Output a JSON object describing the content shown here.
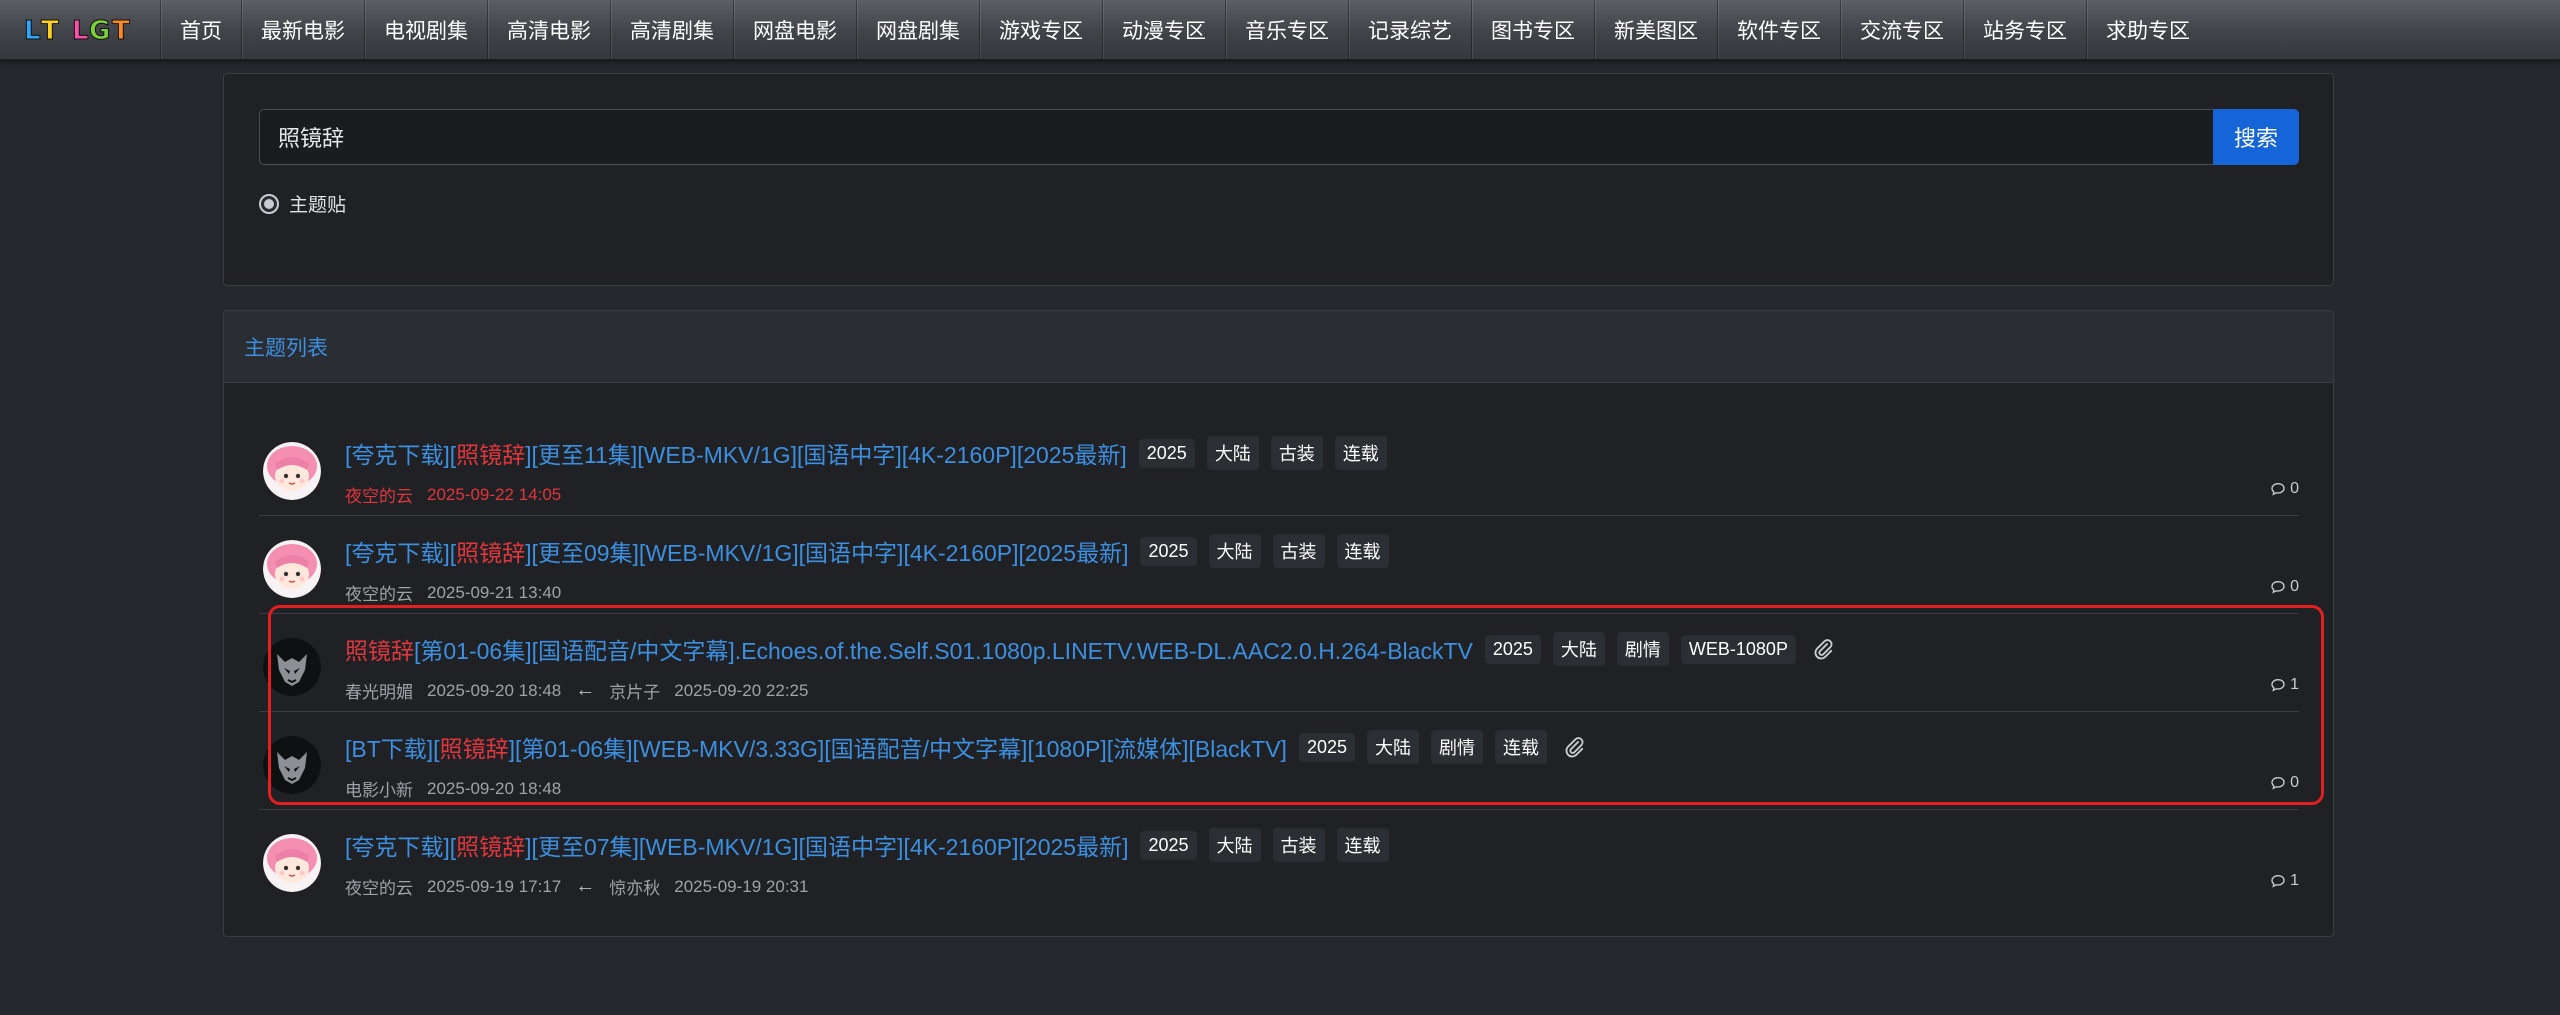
{
  "nav": {
    "logo_text": "LT LGT",
    "items": [
      "首页",
      "最新电影",
      "电视剧集",
      "高清电影",
      "高清剧集",
      "网盘电影",
      "网盘剧集",
      "游戏专区",
      "动漫专区",
      "音乐专区",
      "记录综艺",
      "图书专区",
      "新美图区",
      "软件专区",
      "交流专区",
      "站务专区",
      "求助专区"
    ]
  },
  "search": {
    "value": "照镜辞",
    "button_label": "搜索",
    "radio_label": "主题贴"
  },
  "list": {
    "header": "主题列表",
    "topics": [
      {
        "title_pre": "[夸克下载][",
        "title_hl": "照镜辞",
        "title_post": "][更至11集][WEB-MKV/1G][国语中字][4K-2160P][2025最新]",
        "tags": [
          "2025",
          "大陆",
          "古装",
          "连载"
        ],
        "attachment": false,
        "author": "夜空的云",
        "date": "2025-09-22 14:05",
        "author_red": true,
        "last_user": "",
        "last_date": "",
        "replies": "0",
        "avatar": "pink"
      },
      {
        "title_pre": "[夸克下载][",
        "title_hl": "照镜辞",
        "title_post": "][更至09集][WEB-MKV/1G][国语中字][4K-2160P][2025最新]",
        "tags": [
          "2025",
          "大陆",
          "古装",
          "连载"
        ],
        "attachment": false,
        "author": "夜空的云",
        "date": "2025-09-21 13:40",
        "author_red": false,
        "last_user": "",
        "last_date": "",
        "replies": "0",
        "avatar": "pink"
      },
      {
        "title_pre": "",
        "title_hl": "照镜辞",
        "title_post": "[第01-06集][国语配音/中文字幕].Echoes.of.the.Self.S01.1080p.LINETV.WEB-DL.AAC2.0.H.264-BlackTV",
        "tags": [
          "2025",
          "大陆",
          "剧情",
          "WEB-1080P"
        ],
        "attachment": true,
        "author": "春光明媚",
        "date": "2025-09-20 18:48",
        "author_red": false,
        "last_user": "京片子",
        "last_date": "2025-09-20 22:25",
        "replies": "1",
        "avatar": "dark"
      },
      {
        "title_pre": "[BT下载][",
        "title_hl": "照镜辞",
        "title_post": "][第01-06集][WEB-MKV/3.33G][国语配音/中文字幕][1080P][流媒体][BlackTV]",
        "tags": [
          "2025",
          "大陆",
          "剧情",
          "连载"
        ],
        "attachment": true,
        "author": "电影小新",
        "date": "2025-09-20 18:48",
        "author_red": false,
        "last_user": "",
        "last_date": "",
        "replies": "0",
        "avatar": "dark"
      },
      {
        "title_pre": "[夸克下载][",
        "title_hl": "照镜辞",
        "title_post": "][更至07集][WEB-MKV/1G][国语中字][4K-2160P][2025最新]",
        "tags": [
          "2025",
          "大陆",
          "古装",
          "连载"
        ],
        "attachment": false,
        "author": "夜空的云",
        "date": "2025-09-19 17:17",
        "author_red": false,
        "last_user": "惊亦秋",
        "last_date": "2025-09-19 20:31",
        "replies": "1",
        "avatar": "pink"
      }
    ]
  },
  "colors": {
    "accent_blue": "#3d8fe0",
    "highlight_red": "#e0363d",
    "button_blue": "#1565d8",
    "annotation_red": "#e41f1f"
  }
}
